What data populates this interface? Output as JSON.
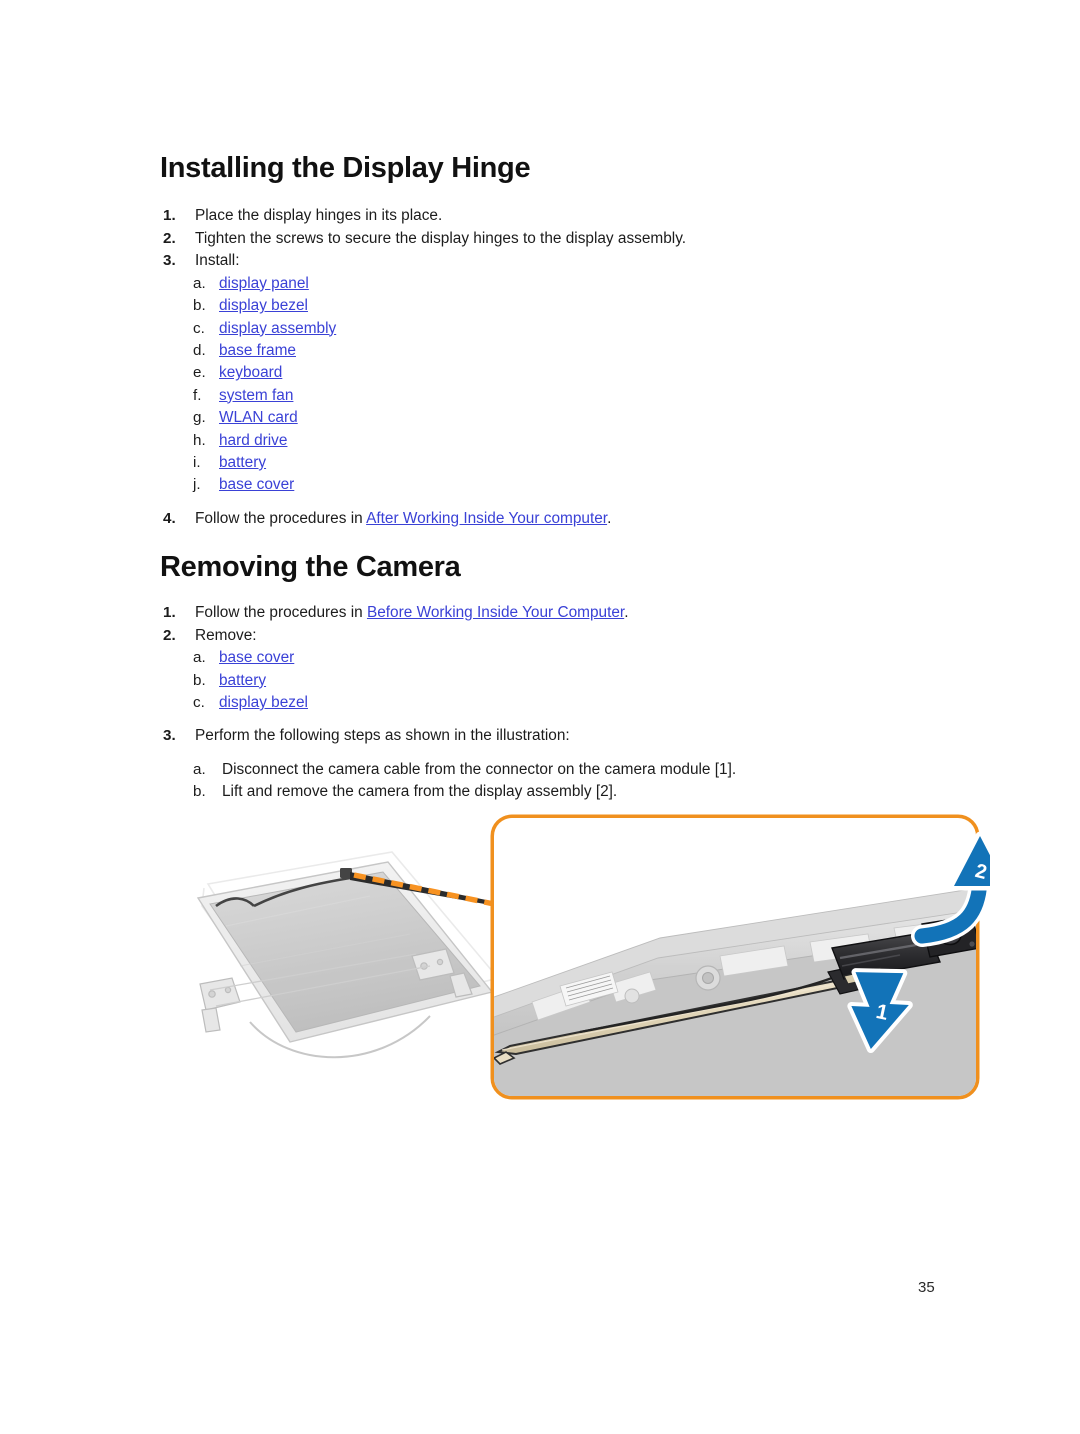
{
  "document": {
    "page_number": "35",
    "link_color": "#3a41d6",
    "callout_border_color": "#F0901E",
    "arrow_color": "#1273B8"
  },
  "sections": [
    {
      "heading": "Installing the Display Hinge",
      "steps": [
        {
          "num": "1.",
          "text": "Place the display hinges in its place."
        },
        {
          "num": "2.",
          "text": "Tighten the screws to secure the display hinges to the display assembly."
        },
        {
          "num": "3.",
          "text": "Install:"
        }
      ],
      "sub_items": [
        {
          "num": "a.",
          "text": "display panel",
          "link": true
        },
        {
          "num": "b.",
          "text": "display bezel",
          "link": true
        },
        {
          "num": "c.",
          "text": "display assembly",
          "link": true
        },
        {
          "num": "d.",
          "text": "base frame",
          "link": true
        },
        {
          "num": "e.",
          "text": "keyboard",
          "link": true
        },
        {
          "num": "f.",
          "text": "system fan",
          "link": true
        },
        {
          "num": "g.",
          "text": "WLAN card",
          "link": true
        },
        {
          "num": "h.",
          "text": "hard drive",
          "link": true
        },
        {
          "num": "i.",
          "text": "battery",
          "link": true
        },
        {
          "num": "j.",
          "text": "base cover",
          "link": true
        }
      ],
      "final_step": {
        "num": "4.",
        "prefix": "Follow the procedures in ",
        "link": "After Working Inside Your computer",
        "suffix": "."
      }
    },
    {
      "heading": "Removing the Camera",
      "step1": {
        "num": "1.",
        "prefix": "Follow the procedures in ",
        "link": "Before Working Inside Your Computer",
        "suffix": "."
      },
      "step2": {
        "num": "2.",
        "text": "Remove:"
      },
      "sub_items": [
        {
          "num": "a.",
          "text": "base cover",
          "link": true
        },
        {
          "num": "b.",
          "text": "battery",
          "link": true
        },
        {
          "num": "c.",
          "text": "display bezel",
          "link": true
        }
      ],
      "step3": {
        "num": "3.",
        "text": "Perform the following steps as shown in the illustration:"
      },
      "step3_sub": [
        {
          "num": "a.",
          "text": "Disconnect the camera cable from the connector on the camera module [1]."
        },
        {
          "num": "b.",
          "text": "Lift and remove the camera from the display assembly [2]."
        }
      ]
    }
  ],
  "illustration": {
    "alt": "Exploded view of laptop display assembly with magnified callout of camera module",
    "callout_labels": [
      {
        "id": "1",
        "meaning": "disconnect-camera-cable"
      },
      {
        "id": "2",
        "meaning": "lift-camera-module"
      }
    ]
  }
}
